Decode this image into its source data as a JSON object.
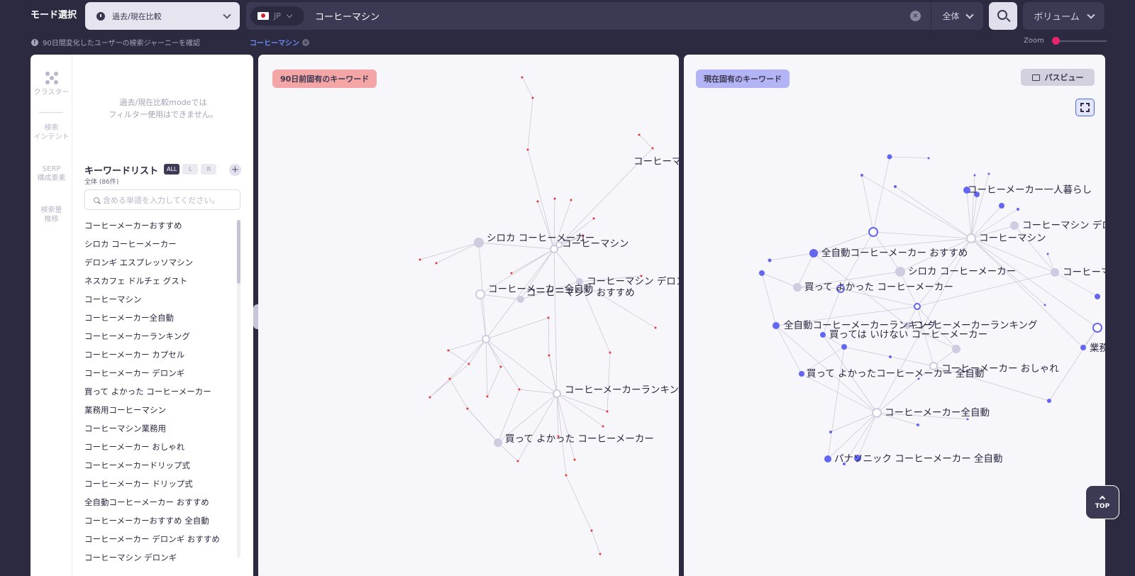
{
  "header": {
    "mode_label": "モード選択",
    "mode_value": "過去/現在比較",
    "country_code": "JP",
    "search_query": "コーヒーマシン",
    "scope_label": "全体",
    "sort_label": "ボリューム",
    "info_text": "90日間変化したユーザーの検索ジャーニーを確認",
    "active_keyword_tag": "コーヒーマシン",
    "zoom_label": "Zoom",
    "zoom_level": 0.0
  },
  "sidebar": {
    "rail": [
      {
        "label": "クラスター",
        "icon": "cluster-icon"
      },
      {
        "label": "検索\nインテント"
      },
      {
        "label": "SERP\n構成要素"
      },
      {
        "label": "検索量\n推移"
      }
    ],
    "filter_note": "過去/現在比較modeでは\nフィルター使用はできません。",
    "keyword_list_title": "キーワードリスト",
    "tabs": [
      "ALL",
      "L",
      "R"
    ],
    "active_tab": "ALL",
    "count_text": "全体 (86件)",
    "search_placeholder": "含める単語を入力してください。",
    "keywords": [
      "コーヒーメーカーおすすめ",
      "シロカ コーヒーメーカー",
      "デロンギ エスプレッソマシン",
      "ネスカフェ ドルチェ グスト",
      "コーヒーマシン",
      "コーヒーメーカー全自動",
      "コーヒーメーカーランキング",
      "コーヒーメーカー カプセル",
      "コーヒーメーカー デロンギ",
      "買って よかった コーヒーメーカー",
      "業務用コーヒーマシン",
      "コーヒーマシン業務用",
      "コーヒーメーカー おしゃれ",
      "コーヒーメーカードリップ式",
      "コーヒーメーカー ドリップ式",
      "全自動コーヒーメーカー おすすめ",
      "コーヒーメーカーおすすめ 全自動",
      "コーヒーメーカー デロンギ おすすめ",
      "コーヒーマシン デロンギ"
    ]
  },
  "left_graph": {
    "tag": "90日前固有のキーワード",
    "tag_color": "#f4a6a6",
    "edge_color": "#c9c3cf",
    "small_node_color": "#e23a3a",
    "node_color": "#cfcbe0",
    "labels": [
      "コーヒーマ",
      "シロカ コーヒーメーカー",
      "コーヒーマシン",
      "コーヒーマシン デロン",
      "コーヒーメーカー全自動",
      "コーヒーマシン おすすめ",
      "コーヒーメーカーランキン",
      "買って よかった コーヒーメーカー"
    ]
  },
  "right_graph": {
    "tag": "現在固有のキーワード",
    "tag_color": "#b3b4f5",
    "path_view_label": "パスビュー",
    "edge_color": "#c9c7d4",
    "accent_node_color": "#6366f1",
    "node_color": "#cfcbe0",
    "labels": [
      "コーヒーメーカー一人暮らし",
      "コーヒーマシン デロ",
      "コーヒーマシン",
      "全自動コーヒーメーカー おすすめ",
      "シロカ コーヒーメーカー",
      "コーヒーマ",
      "買って よかった コーヒーメーカー",
      "全自動コーヒーメーカーランキング",
      "コーヒーメーカーランキング",
      "買っては いけない コーヒーメーカー",
      "業務",
      "コーヒーメーカー おしゃれ",
      "買って よかったコーヒーメーカー 全自動",
      "コーヒーメーカー全自動",
      "パナソニック コーヒーメーカー 全自動"
    ]
  },
  "top_button_label": "TOP"
}
